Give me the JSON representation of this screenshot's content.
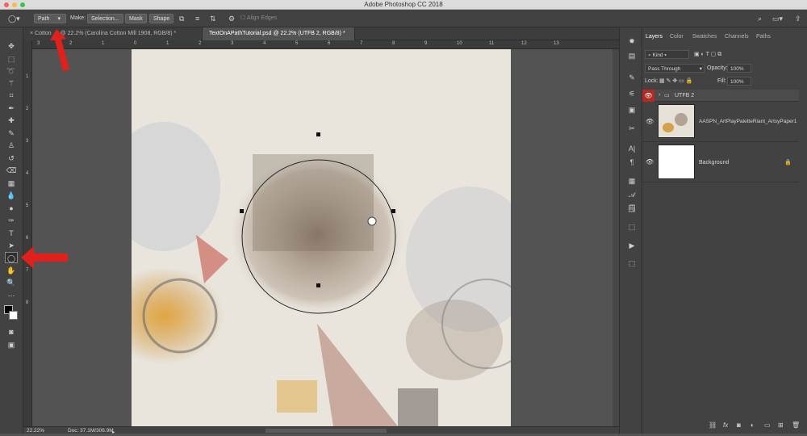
{
  "window": {
    "title": "Adobe Photoshop CC 2018"
  },
  "options": {
    "tool_mode": "Path",
    "make_label": "Make:",
    "selection_btn": "Selection...",
    "mask_btn": "Mask",
    "shape_btn": "Shape",
    "align_edges": "Align Edges"
  },
  "tabs": [
    {
      "label": "Cotton … @ 22.2% (Carolina Cotton Mill 1908, RGB/8) *"
    },
    {
      "label": "TextOnAPathTutorial.psd @ 22.2% (UTFB 2, RGB/8) *"
    }
  ],
  "ruler": {
    "top": [
      "3",
      "2",
      "1",
      "0",
      "1",
      "2",
      "3",
      "4",
      "5",
      "6",
      "7",
      "8",
      "9",
      "10",
      "11",
      "12",
      "13"
    ],
    "left": [
      "1",
      "2",
      "3",
      "4",
      "5",
      "6",
      "7",
      "8"
    ]
  },
  "status": {
    "zoom": "22.22%",
    "doc": "Doc: 37.1M/306.9M"
  },
  "layers_panel": {
    "tabs": [
      "Layers",
      "Color",
      "Swatches",
      "Channels",
      "Paths"
    ],
    "kind": "Kind",
    "blend": "Pass Through",
    "opacity_label": "Opacity:",
    "opacity": "100%",
    "lock_label": "Lock:",
    "fill_label": "Fill:",
    "fill": "100%",
    "layers": [
      {
        "name": "UTFB 2"
      },
      {
        "name": "AASPN_ArtPlayPaletteRiant_ArtsyPaper1"
      },
      {
        "name": "Background"
      }
    ],
    "bottom_icons": [
      "link-icon",
      "fx-icon",
      "mask-icon",
      "adjustment-icon",
      "group-icon",
      "new-layer-icon",
      "trash-icon"
    ]
  },
  "colors": {
    "accent": "#e1201c",
    "active_tab": "#535353"
  }
}
